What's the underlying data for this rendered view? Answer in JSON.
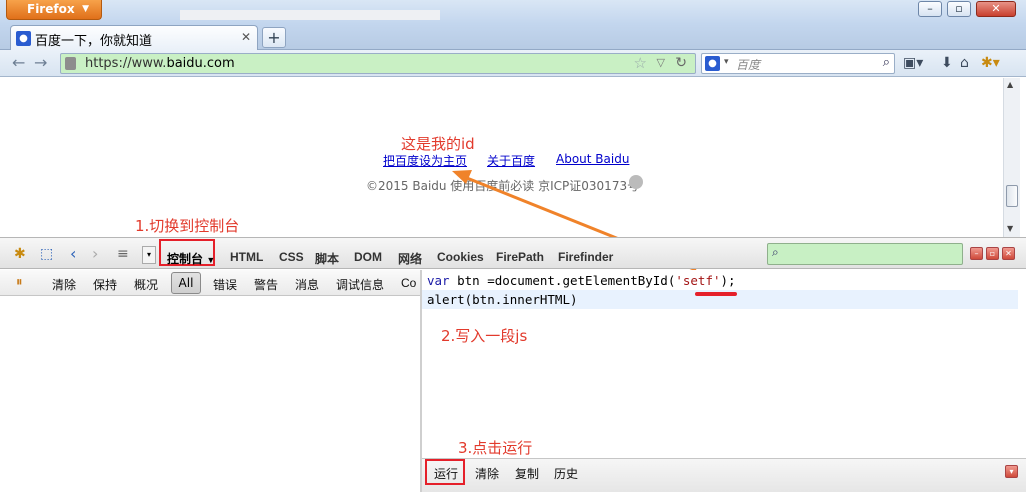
{
  "browser": {
    "app_button": "Firefox",
    "tab_title": "百度一下，你就知道",
    "url_prefix": "https://www.",
    "url_domain": "baidu.com",
    "search_placeholder": "百度"
  },
  "page": {
    "links": [
      "把百度设为主页",
      "关于百度",
      "About Baidu"
    ],
    "copyright": "©2015 Baidu 使用百度前必读 京ICP证030173号"
  },
  "devtools": {
    "console_tab": "控制台",
    "tabs": [
      "HTML",
      "CSS",
      "脚本",
      "DOM",
      "网络",
      "Cookies",
      "FirePath",
      "Firefinder"
    ],
    "filters": [
      "清除",
      "保持",
      "概况",
      "All",
      "错误",
      "警告",
      "消息",
      "调试信息",
      "Co"
    ],
    "code_line1_kw": "var",
    "code_line1_a": " btn =document.getElementById(",
    "code_line1_str": "'setf'",
    "code_line1_b": ");",
    "code_line2": "alert(btn.innerHTML)",
    "footer_buttons": [
      "运行",
      "清除",
      "复制",
      "历史"
    ]
  },
  "annotations": {
    "id_note": "这是我的id",
    "step1": "1.切换到控制台",
    "step2": "2.写入一段js",
    "step3": "3.点击运行"
  },
  "colors": {
    "annotation_red": "#e23a2c",
    "arrow_orange": "#f0832a",
    "url_green": "#c9f0c4"
  }
}
